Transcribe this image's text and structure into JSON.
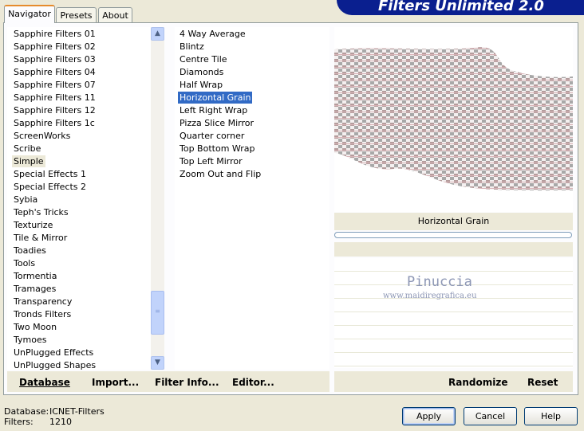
{
  "tabs": [
    {
      "label": "Navigator",
      "active": true
    },
    {
      "label": "Presets",
      "active": false
    },
    {
      "label": "About",
      "active": false
    }
  ],
  "header": {
    "title": "Filters Unlimited 2.0"
  },
  "categories": [
    "Sapphire Filters 01",
    "Sapphire Filters 02",
    "Sapphire Filters 03",
    "Sapphire Filters 04",
    "Sapphire Filters 07",
    "Sapphire Filters 11",
    "Sapphire Filters 12",
    "Sapphire Filters 1c",
    "ScreenWorks",
    "Scribe",
    "Simple",
    "Special Effects 1",
    "Special Effects 2",
    "Sybia",
    "Teph's Tricks",
    "Texturize",
    "Tile & Mirror",
    "Toadies",
    "Tools",
    "Tormentia",
    "Tramages",
    "Transparency",
    "Tronds Filters",
    "Two Moon",
    "Tymoes",
    "UnPlugged Effects",
    "UnPlugged Shapes"
  ],
  "selected_category": "Simple",
  "filters": [
    "4 Way Average",
    "Blintz",
    "Centre Tile",
    "Diamonds",
    "Half Wrap",
    "Horizontal Grain",
    "Left Right Wrap",
    "Pizza Slice Mirror",
    "Quarter corner",
    "Top Bottom Wrap",
    "Top Left Mirror",
    "Zoom Out and Flip"
  ],
  "selected_filter": "Horizontal Grain",
  "bottom_left_buttons": [
    "Database",
    "Import...",
    "Filter Info...",
    "Editor..."
  ],
  "bottom_right_buttons": [
    "Randomize",
    "Reset"
  ],
  "preview": {
    "caption": "Horizontal Grain"
  },
  "watermark": {
    "name": "Pinuccia",
    "url": "www.maidiregrafica.eu"
  },
  "status": {
    "database_label": "Database:",
    "database_value": "ICNET-Filters",
    "filters_label": "Filters:",
    "filters_value": "1210"
  },
  "dialog_buttons": {
    "apply": "Apply",
    "cancel": "Cancel",
    "help": "Help"
  },
  "colors": {
    "banner": "#0A1F8F",
    "selection": "#316AC5",
    "chrome": "#ECE9D8",
    "active_tab_accent": "#E68B2C"
  }
}
